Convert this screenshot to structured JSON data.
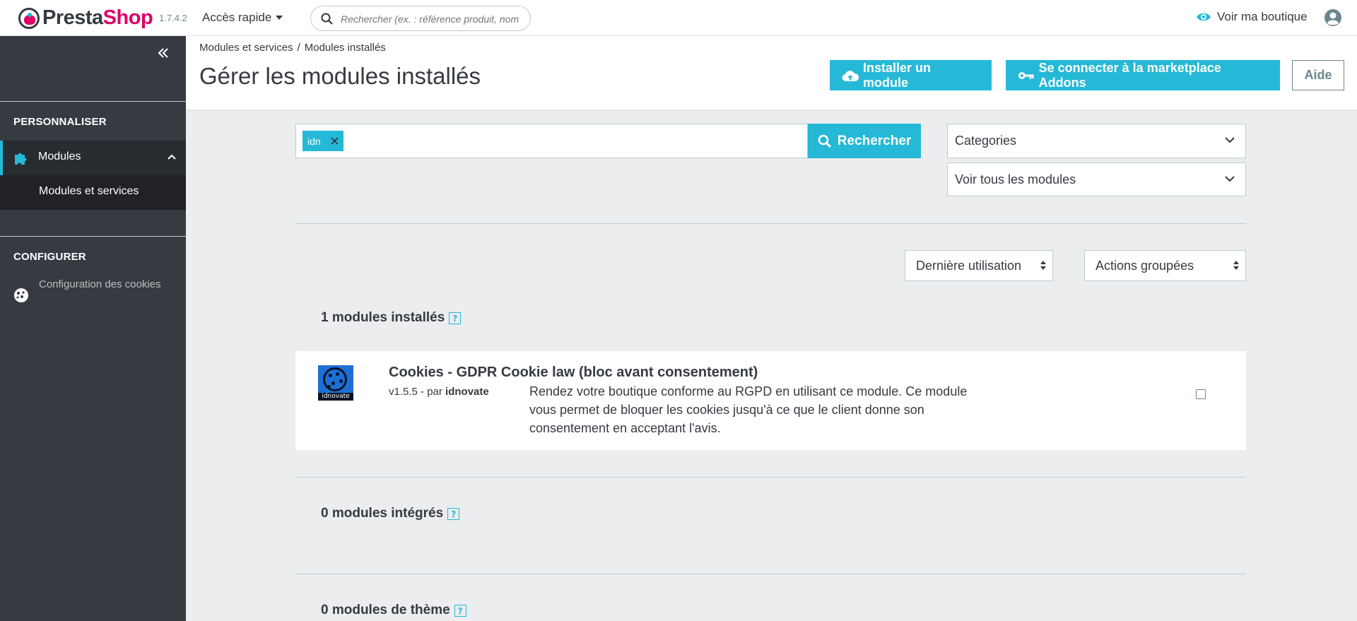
{
  "header": {
    "brand_part1": "Presta",
    "brand_part2": "Shop",
    "version": "1.7.4.2",
    "quick_access": "Accès rapide",
    "search_placeholder": "Rechercher (ex. : référence produit, nom",
    "view_shop": "Voir ma boutique"
  },
  "sidebar": {
    "section1_title": "PERSONNALISER",
    "modules_label": "Modules",
    "modules_services_label": "Modules et services",
    "section2_title": "CONFIGURER",
    "cookies_label": "Configuration des cookies"
  },
  "page": {
    "breadcrumb": [
      "Modules et services",
      "/",
      "Modules installés"
    ],
    "title": "Gérer les modules installés",
    "install_button": "Installer un module",
    "connect_button": "Se connecter à la marketplace Addons",
    "help_button": "Aide"
  },
  "filters": {
    "tag": "idn",
    "search_button": "Rechercher",
    "categories": "Categories",
    "view_all": "Voir tous les modules",
    "sort": "Dernière utilisation",
    "bulk_actions": "Actions groupées"
  },
  "sections": {
    "installed": "1 modules installés",
    "integrated": "0 modules intégrés",
    "theme": "0 modules de thème",
    "help_glyph": "?"
  },
  "module": {
    "logo_text": "idnovate",
    "name": "Cookies - GDPR Cookie law (bloc avant consentement)",
    "version": "v1.5.5 - par",
    "author": "idnovate",
    "description": "Rendez votre boutique conforme au RGPD en utilisant ce module. Ce module vous permet de bloquer les cookies jusqu'à ce que le client donne son consentement en acceptant l'avis."
  },
  "colors": {
    "primary": "#25b9d7",
    "brand_pink": "#df0067",
    "sidebar": "#363a41"
  }
}
